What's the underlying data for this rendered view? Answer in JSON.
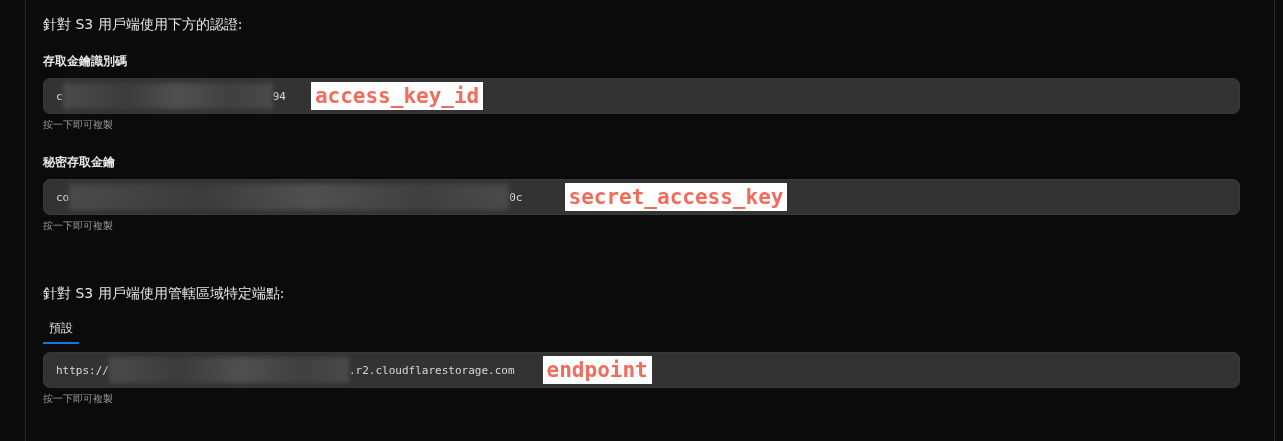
{
  "credentials": {
    "heading": "針對 S3 用戶端使用下方的認證:",
    "fields": [
      {
        "label": "存取金鑰識別碼",
        "value_start": "c",
        "value_end": "94",
        "annotation": "access_key_id",
        "hint": "按一下即可複製"
      },
      {
        "label": "秘密存取金鑰",
        "value_start": "co",
        "value_end": "0c",
        "annotation": "secret_access_key",
        "hint": "按一下即可複製"
      }
    ]
  },
  "endpoints": {
    "heading": "針對 S3 用戶端使用管轄區域特定端點:",
    "tabs": [
      {
        "label": "預設",
        "selected": true
      }
    ],
    "fields": [
      {
        "value_start": "https://",
        "value_end": ".r2.cloudflarestorage.com",
        "annotation": "endpoint",
        "hint": "按一下即可複製"
      }
    ]
  }
}
